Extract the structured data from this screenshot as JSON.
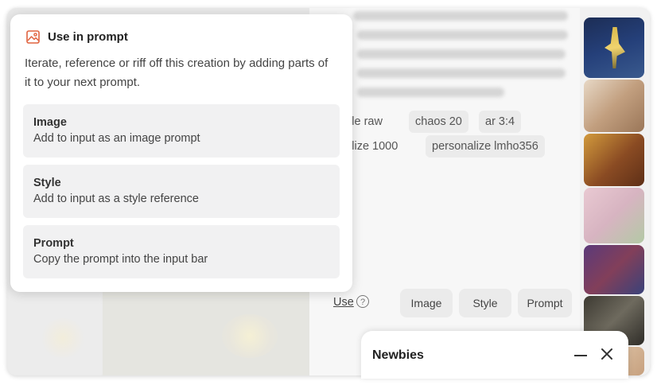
{
  "popover": {
    "title": "Use in prompt",
    "description": "Iterate, reference or riff off this creation by adding parts of it to your next prompt.",
    "options": [
      {
        "title": "Image",
        "subtitle": "Add to input as an image prompt"
      },
      {
        "title": "Style",
        "subtitle": "Add to input as a style reference"
      },
      {
        "title": "Prompt",
        "subtitle": "Copy the prompt into the input bar"
      }
    ]
  },
  "params": {
    "row1": [
      "yle raw",
      "chaos 20",
      "ar 3:4"
    ],
    "row2": [
      "ylize 1000",
      "personalize lmho356"
    ]
  },
  "use_row": {
    "label": "Use",
    "buttons": [
      "Image",
      "Style",
      "Prompt"
    ]
  },
  "newbies": {
    "title": "Newbies"
  },
  "colors": {
    "accent": "#e0633f",
    "popover_bg": "#ffffff",
    "option_bg": "#f1f1f2"
  }
}
